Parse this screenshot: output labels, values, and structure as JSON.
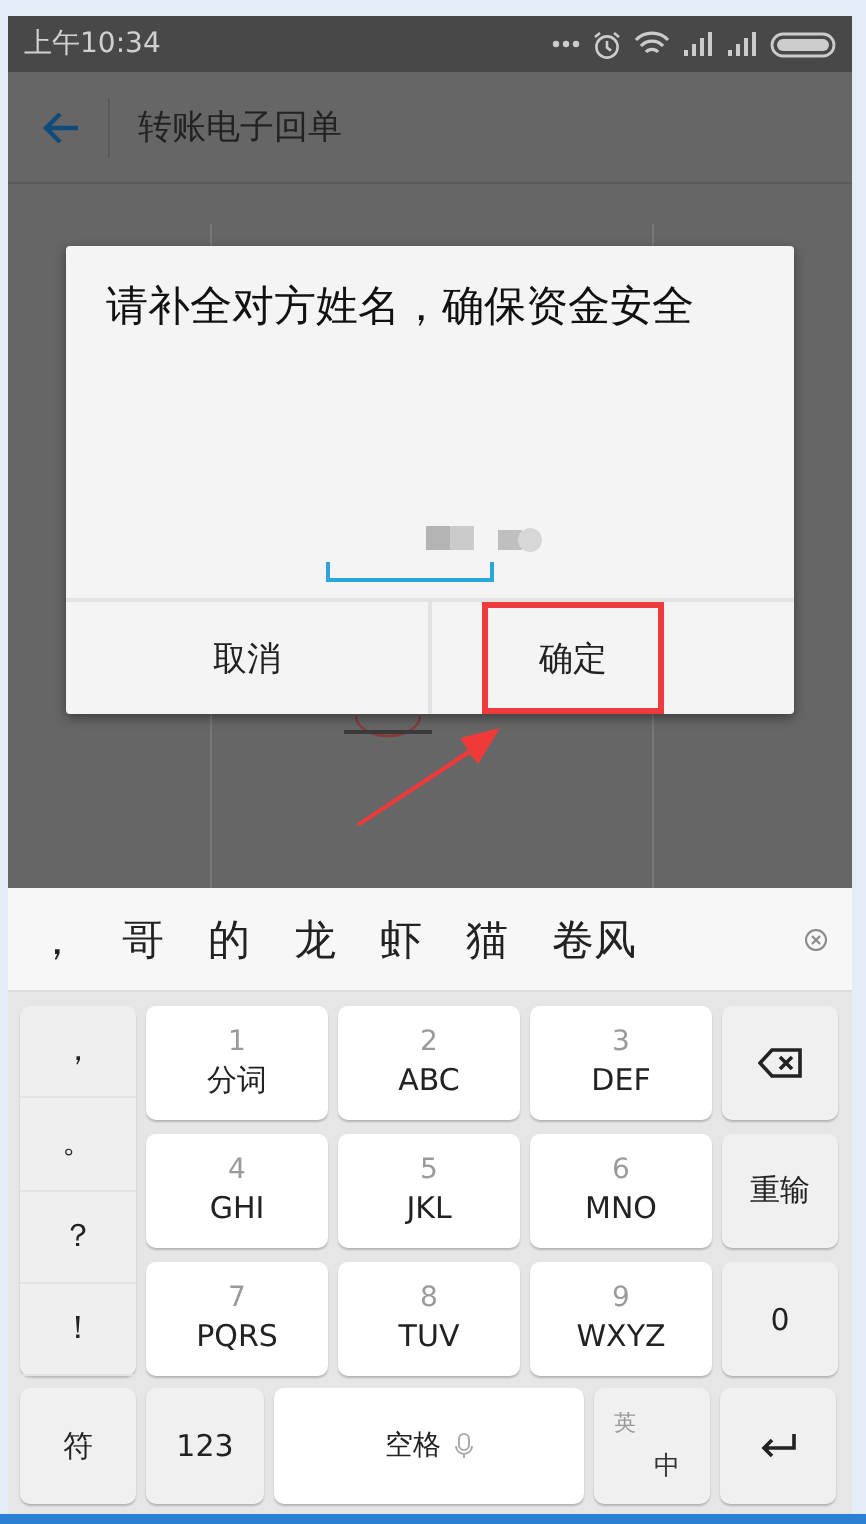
{
  "status_bar": {
    "time": "上午10:34"
  },
  "app_bar": {
    "title": "转账电子回单"
  },
  "dialog": {
    "message": "请补全对方姓名，确保资金安全",
    "buttons": [
      {
        "label": "取消",
        "highlighted": false
      },
      {
        "label": "确定",
        "highlighted": true
      }
    ]
  },
  "candidates": [
    "，",
    "哥",
    "的",
    "龙",
    "虾",
    "猫",
    "卷风"
  ],
  "keyboard": {
    "punctuation": [
      "，",
      "。",
      "？",
      "！"
    ],
    "rows": [
      [
        {
          "kind": "t9",
          "digit": "1",
          "letters": "分词"
        },
        {
          "kind": "t9",
          "digit": "2",
          "letters": "ABC"
        },
        {
          "kind": "t9",
          "digit": "3",
          "letters": "DEF"
        },
        {
          "kind": "backspace"
        }
      ],
      [
        {
          "kind": "t9",
          "digit": "4",
          "letters": "GHI"
        },
        {
          "kind": "t9",
          "digit": "5",
          "letters": "JKL"
        },
        {
          "kind": "t9",
          "digit": "6",
          "letters": "MNO"
        },
        {
          "kind": "text",
          "label": "重输"
        }
      ],
      [
        {
          "kind": "t9",
          "digit": "7",
          "letters": "PQRS"
        },
        {
          "kind": "t9",
          "digit": "8",
          "letters": "TUV"
        },
        {
          "kind": "t9",
          "digit": "9",
          "letters": "WXYZ"
        },
        {
          "kind": "text",
          "label": "0"
        }
      ]
    ],
    "bottom": [
      {
        "kind": "text",
        "label": "符"
      },
      {
        "kind": "text",
        "label": "123"
      },
      {
        "kind": "space",
        "label": "空格"
      },
      {
        "kind": "lang",
        "top": "英",
        "bottom": "中"
      },
      {
        "kind": "enter"
      }
    ]
  }
}
